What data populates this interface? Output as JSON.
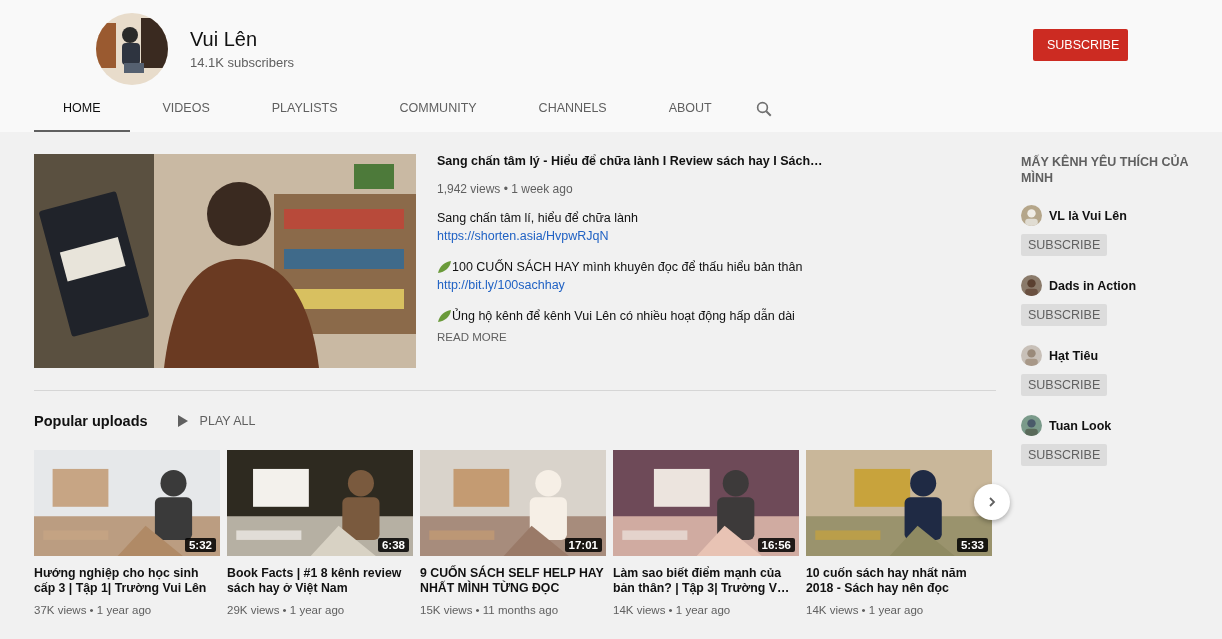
{
  "channel": {
    "name": "Vui Lên",
    "subscribers": "14.1K subscribers",
    "subscribe_label": "SUBSCRIBE"
  },
  "tabs": [
    {
      "label": "HOME",
      "selected": true
    },
    {
      "label": "VIDEOS",
      "selected": false
    },
    {
      "label": "PLAYLISTS",
      "selected": false
    },
    {
      "label": "COMMUNITY",
      "selected": false
    },
    {
      "label": "CHANNELS",
      "selected": false
    },
    {
      "label": "ABOUT",
      "selected": false
    }
  ],
  "featured": {
    "title": "Sang chấn tâm lý - Hiểu để chữa lành I Review sách hay I Sách…",
    "meta": "1,942 views • 1 week ago",
    "description": [
      [
        {
          "kind": "text",
          "text": "Sang chấn tâm lí, hiểu để chữa lành"
        },
        {
          "kind": "link",
          "text": "https://shorten.asia/HvpwRJqN"
        }
      ],
      [
        {
          "kind": "leaf",
          "text": "100 CUỐN SÁCH HAY mình khuyên đọc để thấu hiểu bản thân"
        },
        {
          "kind": "link",
          "text": "http://bit.ly/100sachhay"
        }
      ],
      [
        {
          "kind": "leaf",
          "text": "Ủng hộ kênh để kênh Vui Lên có nhiều hoạt động hấp dẫn dài"
        }
      ]
    ],
    "read_more": "READ MORE"
  },
  "shelf": {
    "title": "Popular uploads",
    "play_all": "PLAY ALL",
    "videos": [
      {
        "duration": "5:32",
        "title": "Hướng nghiệp cho học sinh cấp 3 | Tập 1| Trường Vui Lên",
        "meta": "37K views • 1 year ago"
      },
      {
        "duration": "6:38",
        "title": "Book Facts | #1 8 kênh review sách hay ở Việt Nam",
        "meta": "29K views • 1 year ago"
      },
      {
        "duration": "17:01",
        "title": "9 CUỐN SÁCH SELF HELP HAY NHẤT MÌNH TỪNG ĐỌC",
        "meta": "15K views • 11 months ago"
      },
      {
        "duration": "16:56",
        "title": "Làm sao biết điểm mạnh của bản thân? | Tập 3| Trường V…",
        "meta": "14K views • 1 year ago"
      },
      {
        "duration": "5:33",
        "title": "10 cuốn sách hay nhất năm 2018 - Sách hay nên đọc",
        "meta": "14K views • 1 year ago"
      }
    ]
  },
  "sidebar": {
    "title": "MẤY KÊNH YÊU THÍCH CỦA MÌNH",
    "channels": [
      {
        "name": "VL là Vui Lên",
        "subscribe_label": "SUBSCRIBE"
      },
      {
        "name": "Dads in Action",
        "subscribe_label": "SUBSCRIBE"
      },
      {
        "name": "Hạt Tiêu",
        "subscribe_label": "SUBSCRIBE"
      },
      {
        "name": "Tuan Look",
        "subscribe_label": "SUBSCRIBE"
      }
    ]
  }
}
